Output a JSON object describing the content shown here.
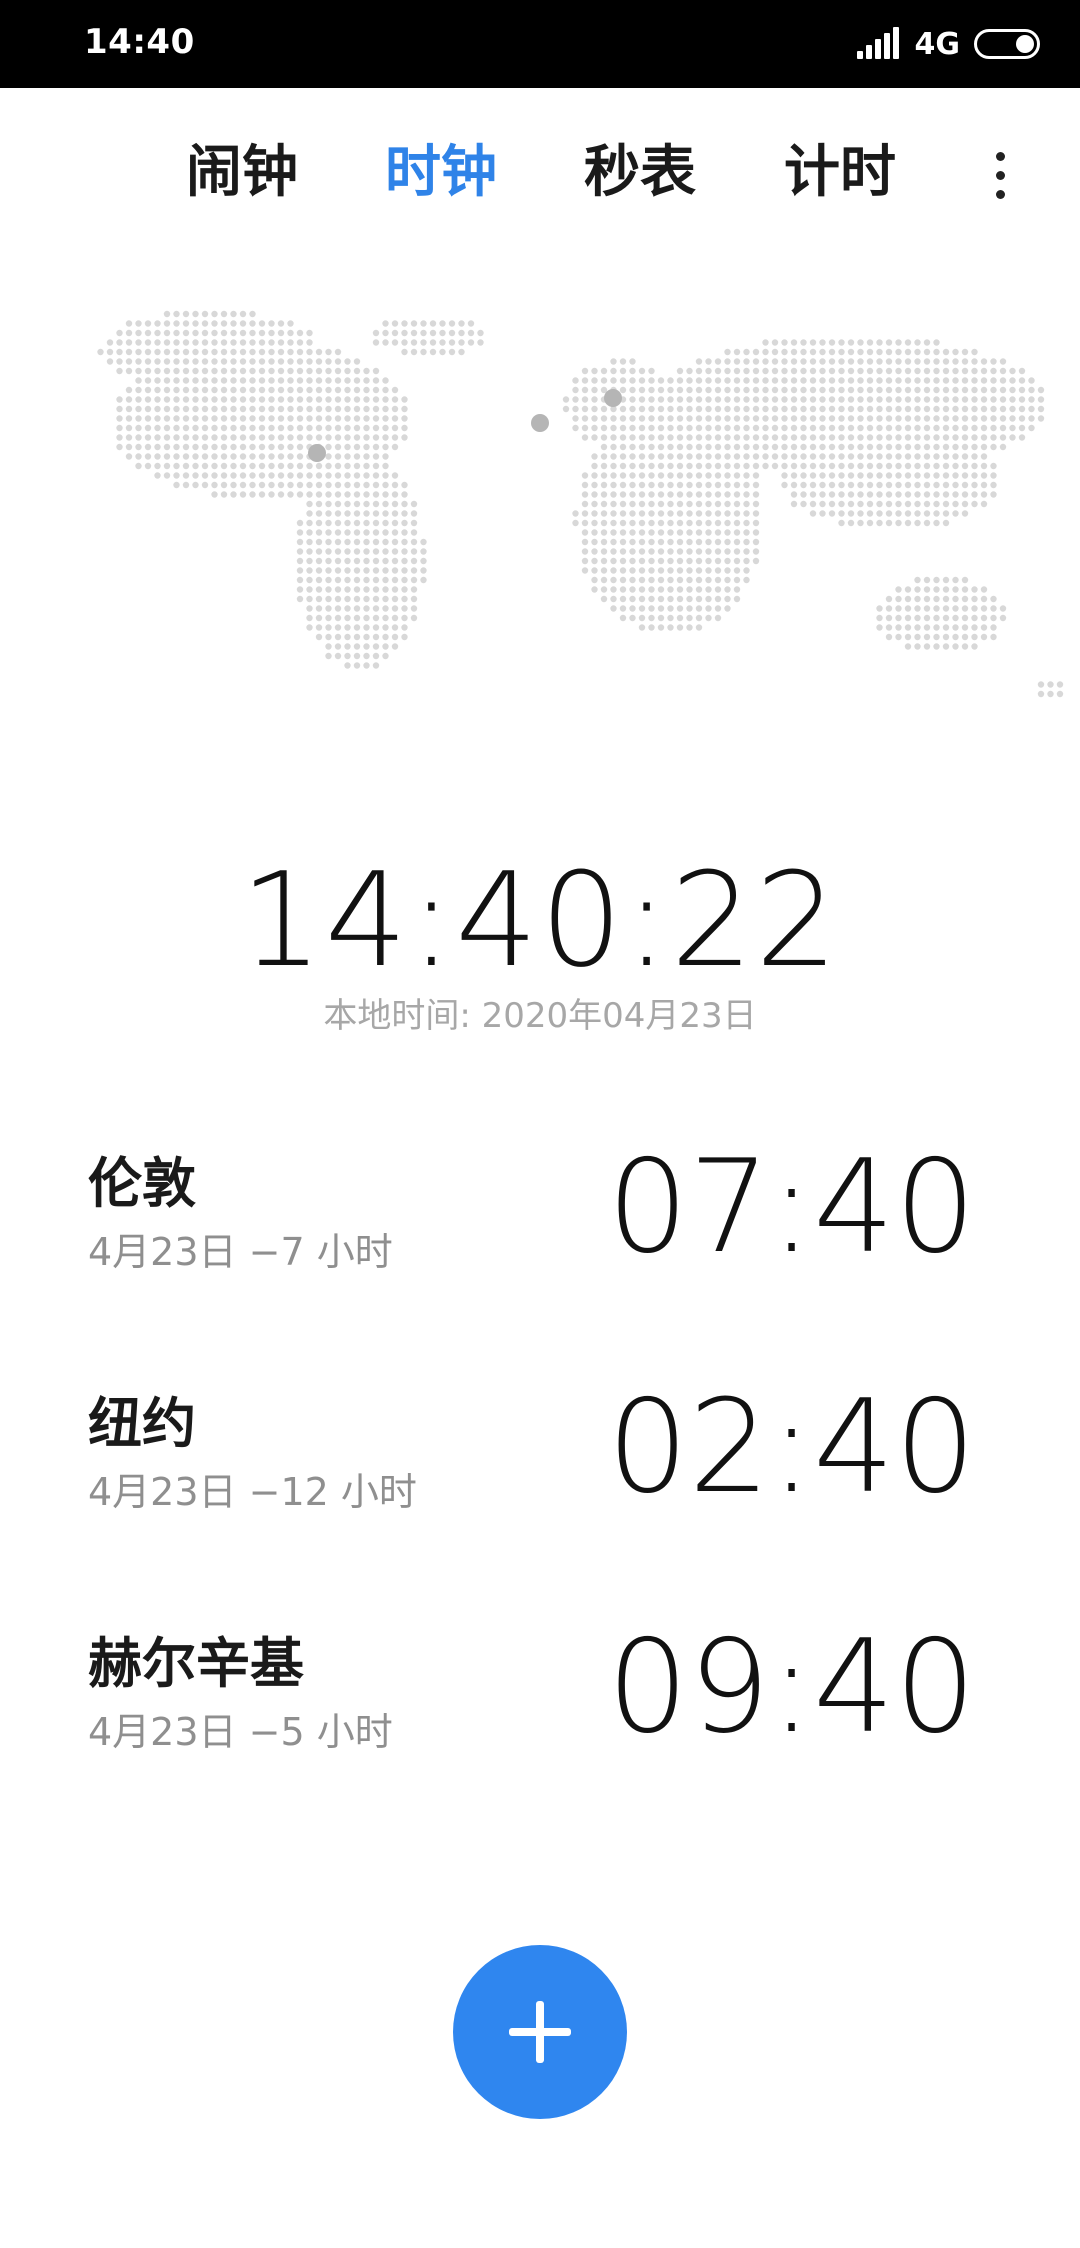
{
  "status_bar": {
    "time": "14:40",
    "network": "4G",
    "icons": [
      "signal-icon",
      "battery-icon"
    ]
  },
  "tabs": [
    {
      "label": "闹钟",
      "active": false
    },
    {
      "label": "时钟",
      "active": true
    },
    {
      "label": "秒表",
      "active": false
    },
    {
      "label": "计时",
      "active": false
    }
  ],
  "main_clock": {
    "time": "14:40:22",
    "local_date": "本地时间: 2020年04月23日"
  },
  "cities": [
    {
      "name": "伦敦",
      "info": "4月23日 −7 小时",
      "time": "07:40"
    },
    {
      "name": "纽约",
      "info": "4月23日 −12 小时",
      "time": "02:40"
    },
    {
      "name": "赫尔辛基",
      "info": "4月23日 −5 小时",
      "time": "09:40"
    }
  ],
  "colors": {
    "accent": "#2f83e8",
    "fab": "#2f86ef",
    "map_dot": "#d8d8d8",
    "map_marker": "#b5b5b5"
  },
  "fab_icon": "plus-icon"
}
